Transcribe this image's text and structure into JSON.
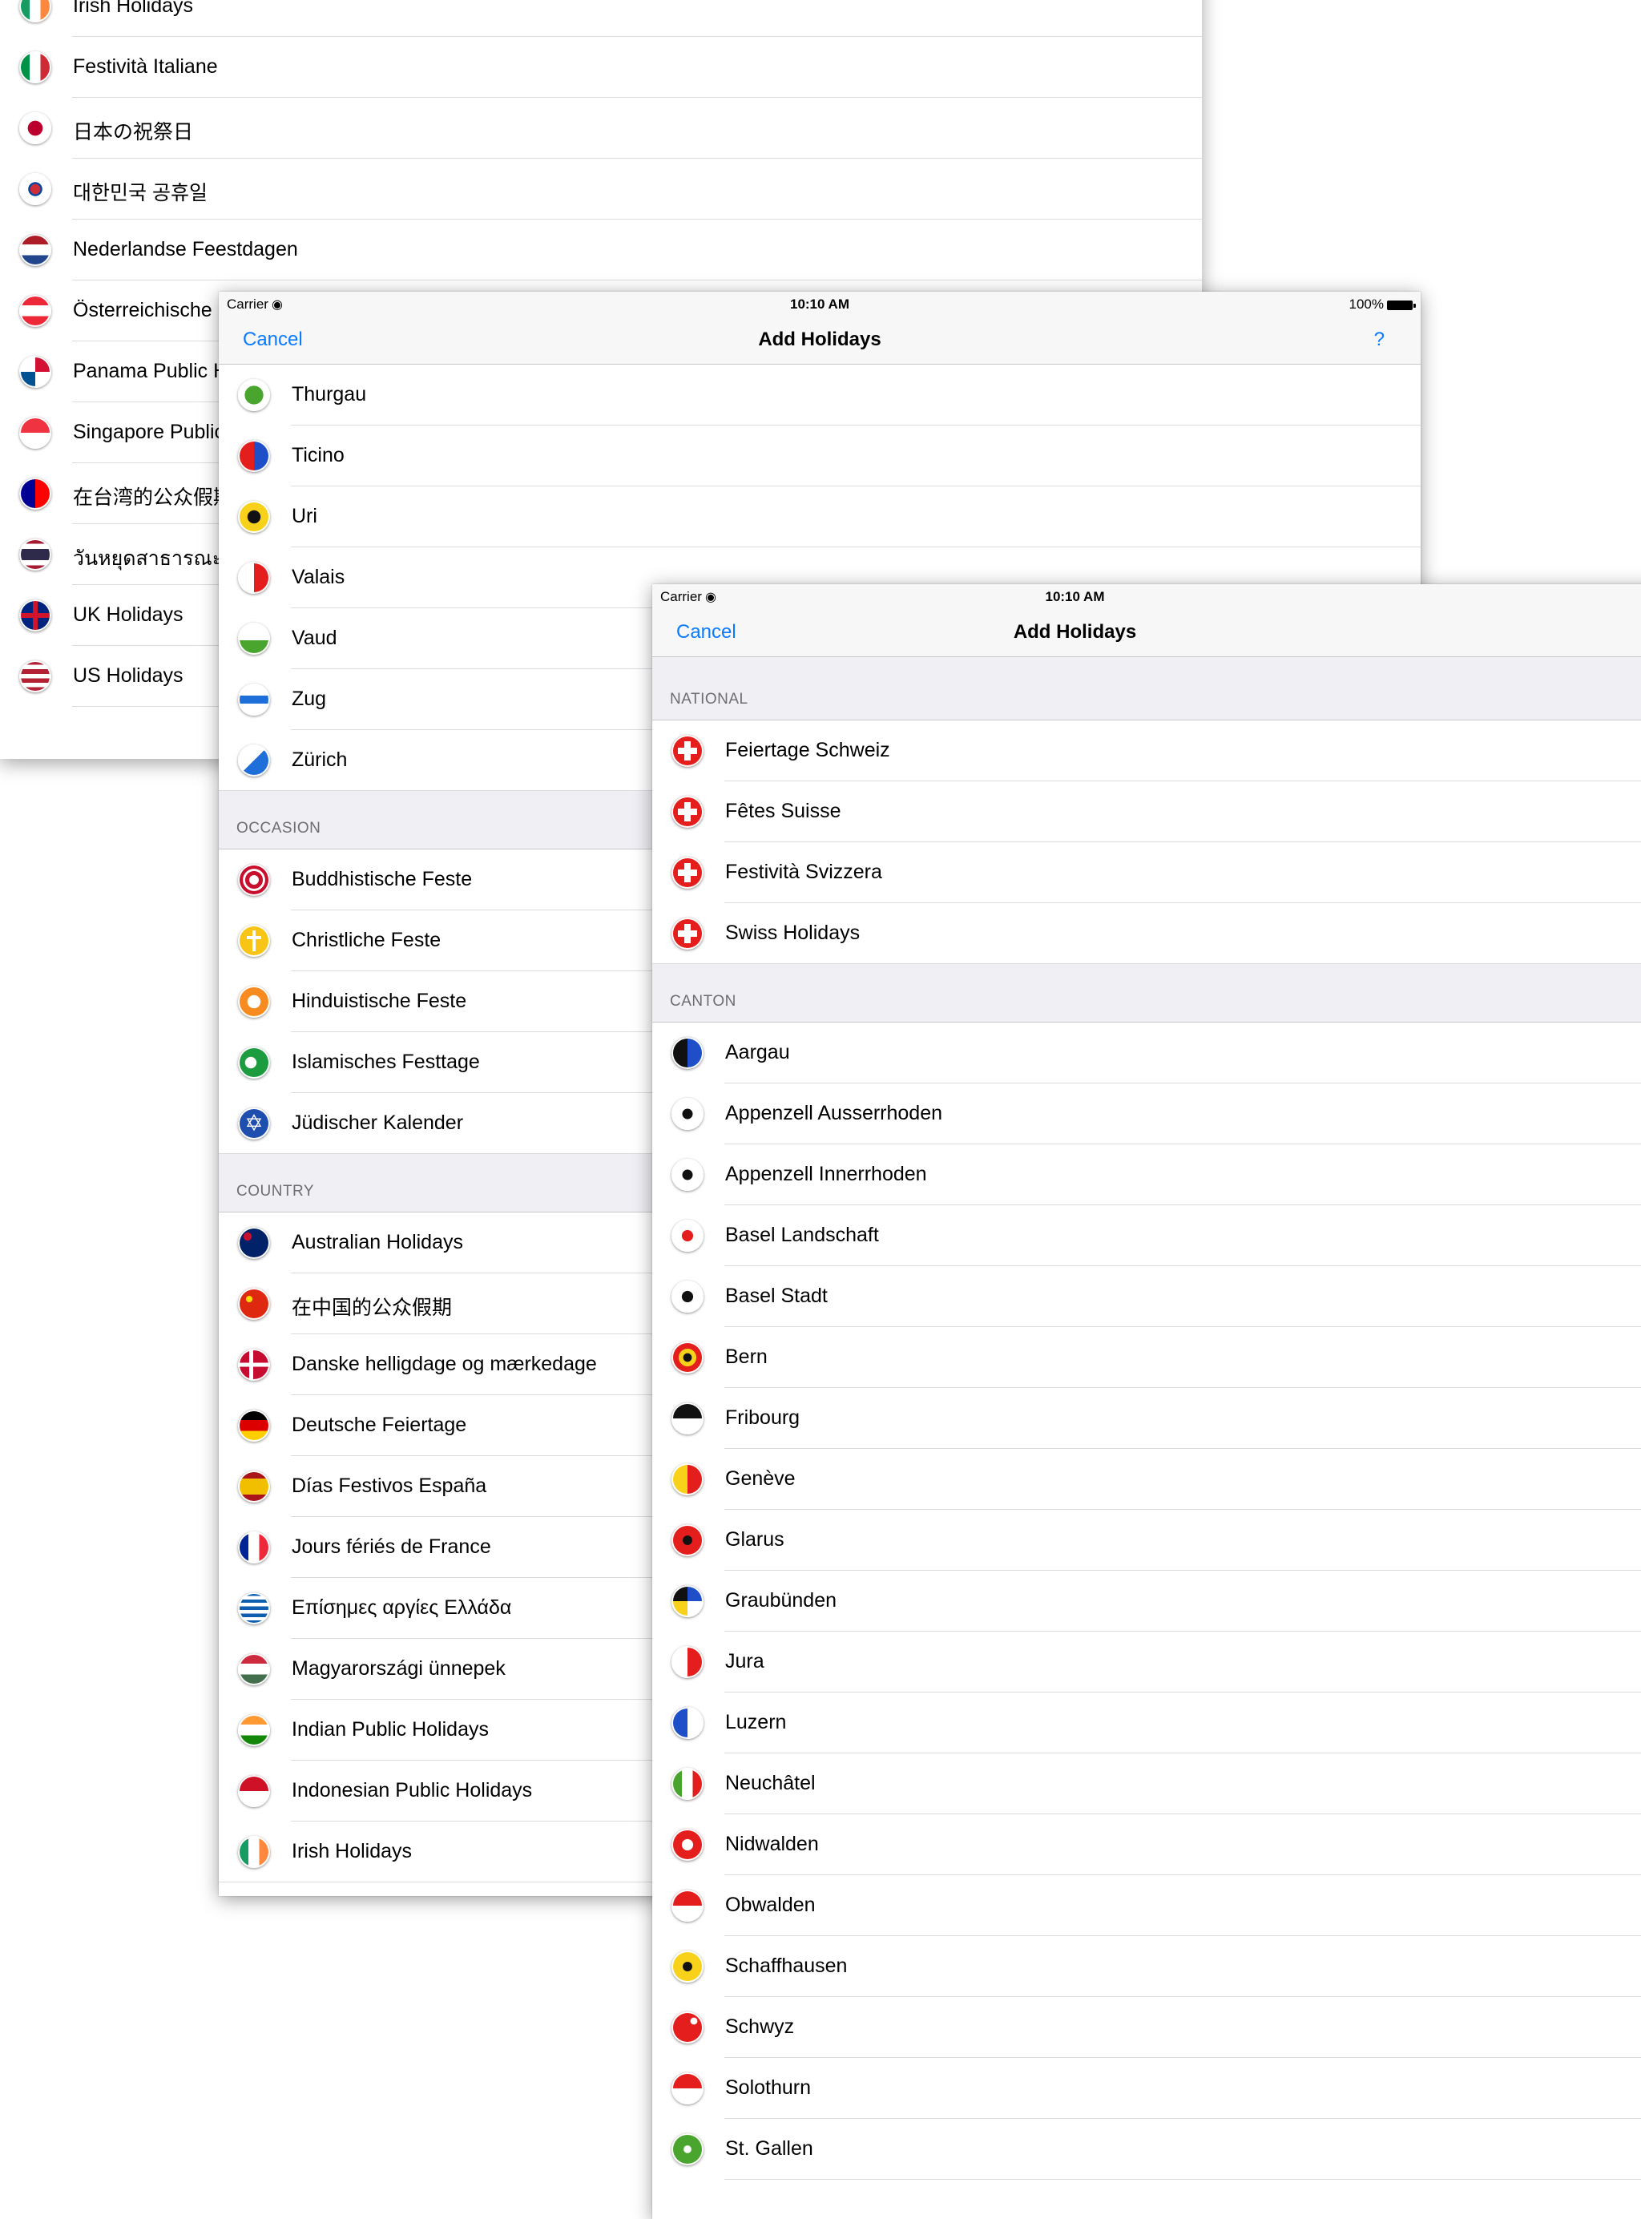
{
  "panel1": {
    "rows": [
      {
        "label": "Irish Holidays",
        "flag": "f-ie"
      },
      {
        "label": "Festività Italiane",
        "flag": "f-it"
      },
      {
        "label": "日本の祝祭日",
        "flag": "f-jp"
      },
      {
        "label": "대한민국 공휴일",
        "flag": "f-kr"
      },
      {
        "label": "Nederlandse Feestdagen",
        "flag": "f-nl"
      },
      {
        "label": "Österreichische",
        "flag": "f-at"
      },
      {
        "label": "Panama Public H",
        "flag": "f-pa"
      },
      {
        "label": "Singapore Public",
        "flag": "f-sg"
      },
      {
        "label": "在台湾的公众假期",
        "flag": "f-tw"
      },
      {
        "label": "วันหยุดสาธารณะแ",
        "flag": "f-th"
      },
      {
        "label": "UK Holidays",
        "flag": "f-uk"
      },
      {
        "label": "US Holidays",
        "flag": "f-us"
      }
    ]
  },
  "panel2": {
    "status": {
      "carrier": "Carrier",
      "time": "10:10 AM",
      "battery": "100%"
    },
    "nav": {
      "cancel": "Cancel",
      "title": "Add Holidays",
      "help": "?"
    },
    "cantons": [
      {
        "label": "Thurgau",
        "flag": "f-green"
      },
      {
        "label": "Ticino",
        "flag": "f-redblue"
      },
      {
        "label": "Uri",
        "flag": "f-uri"
      },
      {
        "label": "Valais",
        "flag": "f-vs"
      },
      {
        "label": "Vaud",
        "flag": "f-vd"
      },
      {
        "label": "Zug",
        "flag": "f-zg"
      },
      {
        "label": "Zürich",
        "flag": "f-zh"
      }
    ],
    "occasion_title": "OCCASION",
    "occasion": [
      {
        "label": "Buddhistische Feste",
        "flag": "relig-red"
      },
      {
        "label": "Christliche Feste",
        "flag": "relig-yellow"
      },
      {
        "label": "Hinduistische Feste",
        "flag": "relig-orange"
      },
      {
        "label": "Islamisches Festtage",
        "flag": "relig-green"
      },
      {
        "label": "Jüdischer Kalender",
        "flag": "relig-blue"
      }
    ],
    "country_title": "COUNTRY",
    "country": [
      {
        "label": "Australian Holidays",
        "flag": "f-au"
      },
      {
        "label": "在中国的公众假期",
        "flag": "f-cn"
      },
      {
        "label": "Danske helligdage og mærkedage",
        "flag": "f-dk"
      },
      {
        "label": "Deutsche Feiertage",
        "flag": "f-de"
      },
      {
        "label": "Días Festivos España",
        "flag": "f-es"
      },
      {
        "label": "Jours fériés de France",
        "flag": "f-fr"
      },
      {
        "label": "Επίσημες αργίες Ελλάδα",
        "flag": "f-gr"
      },
      {
        "label": "Magyarországi ünnepek",
        "flag": "f-hu"
      },
      {
        "label": "Indian Public Holidays",
        "flag": "f-in"
      },
      {
        "label": "Indonesian Public Holidays",
        "flag": "f-id"
      },
      {
        "label": "Irish Holidays",
        "flag": "f-ie"
      }
    ]
  },
  "panel3": {
    "status": {
      "carrier": "Carrier",
      "time": "10:10 AM"
    },
    "nav": {
      "cancel": "Cancel",
      "title": "Add Holidays"
    },
    "national_title": "NATIONAL",
    "national": [
      {
        "label": "Feiertage Schweiz",
        "flag": "f-swiss"
      },
      {
        "label": "Fêtes Suisse",
        "flag": "f-swiss"
      },
      {
        "label": "Festività Svizzera",
        "flag": "f-swiss"
      },
      {
        "label": "Swiss Holidays",
        "flag": "f-swiss"
      }
    ],
    "canton_title": "CANTON",
    "canton": [
      {
        "label": "Aargau",
        "flag": "f-ag"
      },
      {
        "label": "Appenzell Ausserrhoden",
        "flag": "f-bear"
      },
      {
        "label": "Appenzell Innerrhoden",
        "flag": "f-bear"
      },
      {
        "label": "Basel Landschaft",
        "flag": "f-bl"
      },
      {
        "label": "Basel Stadt",
        "flag": "f-bs"
      },
      {
        "label": "Bern",
        "flag": "f-be"
      },
      {
        "label": "Fribourg",
        "flag": "f-fr2"
      },
      {
        "label": "Genève",
        "flag": "f-ge"
      },
      {
        "label": "Glarus",
        "flag": "f-gl"
      },
      {
        "label": "Graubünden",
        "flag": "f-gr2"
      },
      {
        "label": "Jura",
        "flag": "f-ju"
      },
      {
        "label": "Luzern",
        "flag": "f-lu"
      },
      {
        "label": "Neuchâtel",
        "flag": "f-ne"
      },
      {
        "label": "Nidwalden",
        "flag": "f-nw"
      },
      {
        "label": "Obwalden",
        "flag": "f-ow"
      },
      {
        "label": "Schaffhausen",
        "flag": "f-sh"
      },
      {
        "label": "Schwyz",
        "flag": "f-sz"
      },
      {
        "label": "Solothurn",
        "flag": "f-so"
      },
      {
        "label": "St. Gallen",
        "flag": "f-sg2"
      }
    ]
  }
}
